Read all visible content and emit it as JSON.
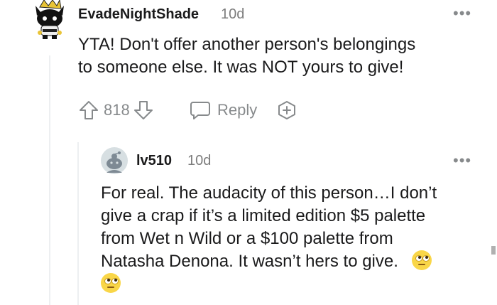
{
  "comment": {
    "username": "EvadeNightShade",
    "timestamp": "10d",
    "body_lines": [
      "YTA! Don't offer another person's belongings",
      "to someone else. It was NOT yours to give!"
    ],
    "score": "818",
    "reply_label": "Reply",
    "more_label": "•••"
  },
  "reply": {
    "username": "lv510",
    "timestamp": "10d",
    "body_lines": [
      "For real. The audacity of this person…I don’t",
      "give a crap if it’s a limited edition $5 palette",
      "from Wet n Wild or a $100 palette from",
      "Natasha Denona. It wasn’t hers to give."
    ],
    "emoji": "face-with-rolling-eyes",
    "more_label": "•••"
  },
  "colors": {
    "text": "#1a1a1b",
    "meta": "#7c7c7c",
    "icon": "#878a8c",
    "thread_line": "#edeff1"
  }
}
